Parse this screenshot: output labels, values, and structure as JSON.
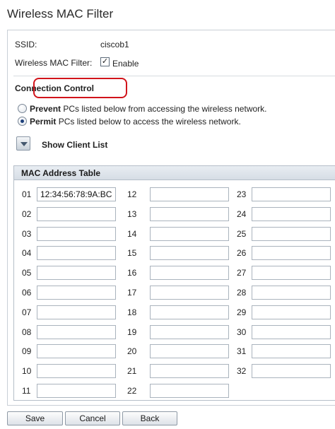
{
  "page": {
    "title": "Wireless MAC Filter"
  },
  "settings": {
    "ssid_label": "SSID:",
    "ssid_value": "ciscob1",
    "filter_label": "Wireless MAC Filter:",
    "enable_checked": true,
    "enable_label": "Enable"
  },
  "connection_control": {
    "heading": "Connection Control",
    "prevent_bold": "Prevent",
    "prevent_text": "PCs listed below from accessing the wireless network.",
    "permit_bold": "Permit",
    "permit_text": "PCs listed below to access the wireless network.",
    "selected": "permit"
  },
  "client_list": {
    "label": "Show Client List"
  },
  "mac_table": {
    "header": "MAC Address Table",
    "entries": [
      {
        "num": "01",
        "value": "12:34:56:78:9A:BC"
      },
      {
        "num": "02",
        "value": ""
      },
      {
        "num": "03",
        "value": ""
      },
      {
        "num": "04",
        "value": ""
      },
      {
        "num": "05",
        "value": ""
      },
      {
        "num": "06",
        "value": ""
      },
      {
        "num": "07",
        "value": ""
      },
      {
        "num": "08",
        "value": ""
      },
      {
        "num": "09",
        "value": ""
      },
      {
        "num": "10",
        "value": ""
      },
      {
        "num": "11",
        "value": ""
      },
      {
        "num": "12",
        "value": ""
      },
      {
        "num": "13",
        "value": ""
      },
      {
        "num": "14",
        "value": ""
      },
      {
        "num": "15",
        "value": ""
      },
      {
        "num": "16",
        "value": ""
      },
      {
        "num": "17",
        "value": ""
      },
      {
        "num": "18",
        "value": ""
      },
      {
        "num": "19",
        "value": ""
      },
      {
        "num": "20",
        "value": ""
      },
      {
        "num": "21",
        "value": ""
      },
      {
        "num": "22",
        "value": ""
      },
      {
        "num": "23",
        "value": ""
      },
      {
        "num": "24",
        "value": ""
      },
      {
        "num": "25",
        "value": ""
      },
      {
        "num": "26",
        "value": ""
      },
      {
        "num": "27",
        "value": ""
      },
      {
        "num": "28",
        "value": ""
      },
      {
        "num": "29",
        "value": ""
      },
      {
        "num": "30",
        "value": ""
      },
      {
        "num": "31",
        "value": ""
      },
      {
        "num": "32",
        "value": ""
      }
    ]
  },
  "buttons": {
    "save": "Save",
    "cancel": "Cancel",
    "back": "Back"
  },
  "colors": {
    "highlight": "#d1141b",
    "radio_dot": "#1d3f7a"
  }
}
